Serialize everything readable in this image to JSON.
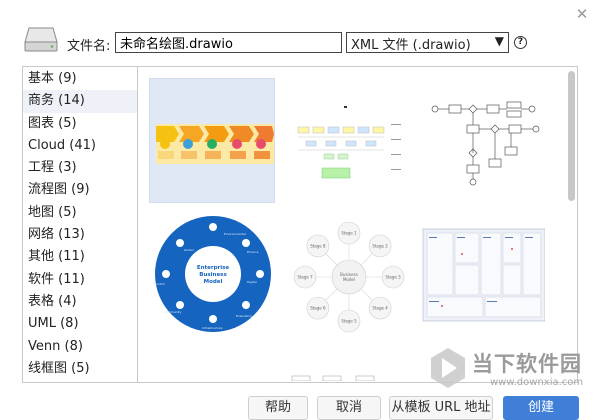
{
  "dialog": {
    "close_icon": "close-icon",
    "drive_icon": "hard-drive-icon"
  },
  "filename": {
    "label": "文件名:",
    "value": "未命名绘图.drawio"
  },
  "format": {
    "selected": "XML 文件 (.drawio)",
    "caret": "▼",
    "help": "?"
  },
  "categories": [
    {
      "label": "基本 (9)"
    },
    {
      "label": "商务 (14)",
      "selected": true
    },
    {
      "label": "图表 (5)"
    },
    {
      "label": "Cloud (41)"
    },
    {
      "label": "工程 (3)"
    },
    {
      "label": "流程图 (9)"
    },
    {
      "label": "地图 (5)"
    },
    {
      "label": "网络 (13)"
    },
    {
      "label": "其他 (11)"
    },
    {
      "label": "软件 (11)"
    },
    {
      "label": "表格 (4)"
    },
    {
      "label": "UML (8)"
    },
    {
      "label": "Venn (8)"
    },
    {
      "label": "线框图 (5)"
    }
  ],
  "templates": {
    "enterprise": {
      "line1": "Enterprise",
      "line2": "Business",
      "line3": "Model"
    },
    "stages": {
      "center1": "Business",
      "center2": "Model",
      "items": [
        "Stage 1",
        "Stage 2",
        "Stage 3",
        "Stage 4",
        "Stage 5",
        "Stage 6",
        "Stage 7",
        "Stage 8"
      ]
    }
  },
  "footer": {
    "help": "帮助",
    "cancel": "取消",
    "from_template_url": "从模板 URL 地址",
    "create": "创建"
  },
  "watermark": {
    "title": "当下软件园",
    "url": "www.downxia.com"
  },
  "colors": {
    "selection": "#dfe8f4",
    "primary_button": "#3f7fd8",
    "enterprise_blue": "#1565c0"
  }
}
